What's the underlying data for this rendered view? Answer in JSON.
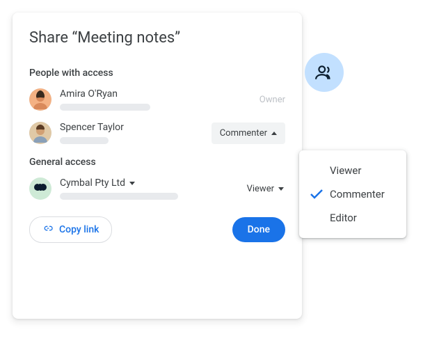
{
  "dialog": {
    "title": "Share “Meeting notes”",
    "people_section_label": "People with access",
    "general_section_label": "General access",
    "people": [
      {
        "name": "Amira O'Ryan",
        "role_label": "Owner",
        "role_type": "static"
      },
      {
        "name": "Spencer Taylor",
        "role_label": "Commenter",
        "role_type": "open_select"
      }
    ],
    "org": {
      "name": "Cymbal Pty Ltd",
      "role_label": "Viewer"
    },
    "copy_link_label": "Copy link",
    "done_label": "Done"
  },
  "role_menu": {
    "options": [
      "Viewer",
      "Commenter",
      "Editor"
    ],
    "selected": "Commenter"
  }
}
